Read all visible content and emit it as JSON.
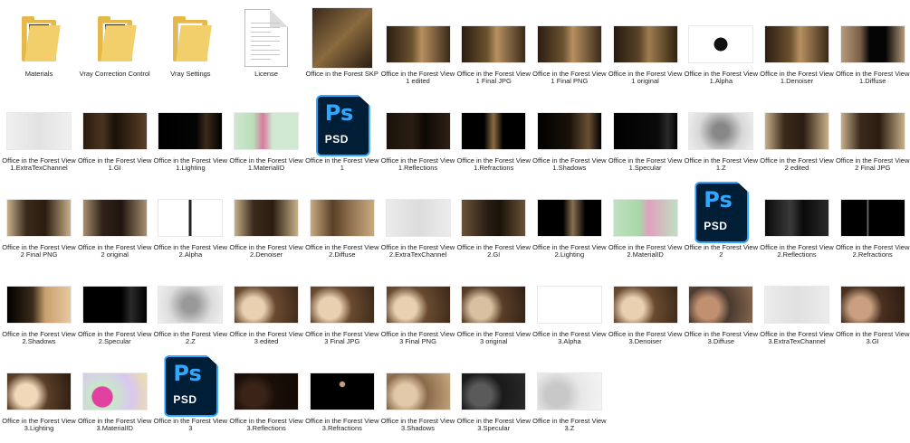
{
  "files": [
    {
      "label": "Materials",
      "kind": "folder",
      "inner": "#2a2a2a"
    },
    {
      "label": "Vray Correction Control",
      "kind": "folder",
      "inner": "#1c2733"
    },
    {
      "label": "Vray Settings",
      "kind": "folder",
      "inner": "#ffffff"
    },
    {
      "label": "License",
      "kind": "doc"
    },
    {
      "label": "Office in the Forest SKP",
      "kind": "square",
      "bg": "linear-gradient(135deg,#3a2a1c,#8a6a3e 50%,#2a1d12)"
    },
    {
      "label": "Office in the Forest View 1 edited",
      "kind": "img",
      "bg": "linear-gradient(90deg,#2b1d12,#6b5230 40%,#b89060 55%,#3a2a1a)"
    },
    {
      "label": "Office in the Forest View 1 Final JPG",
      "kind": "img",
      "bg": "linear-gradient(90deg,#2b1d12,#6b5230 40%,#b89060 55%,#3a2a1a)"
    },
    {
      "label": "Office in the Forest View 1 Final PNG",
      "kind": "img",
      "bg": "linear-gradient(90deg,#2b1d12,#6b5230 40%,#b89060 55%,#3a2a1a)"
    },
    {
      "label": "Office in the Forest View 1 original",
      "kind": "img",
      "bg": "linear-gradient(90deg,#251a10,#5b4428 40%,#a07c50 55%,#30220f)"
    },
    {
      "label": "Office in the Forest View 1.Alpha",
      "kind": "img",
      "bg": "radial-gradient(circle at 50% 50%,#111 0 18%,#ffffff 19%)"
    },
    {
      "label": "Office in the Forest View 1.Denoiser",
      "kind": "img",
      "bg": "linear-gradient(90deg,#2b1d12,#6b5230 40%,#b89060 55%,#3a2a1a)"
    },
    {
      "label": "Office in the Forest View 1.Diffuse",
      "kind": "img",
      "bg": "linear-gradient(90deg,#b59a7a,#7a6048 30%,#050505 45%,#050505 70%,#b59a7a)"
    },
    {
      "label": "Office in the Forest View 1.ExtraTexChannel",
      "kind": "img",
      "bg": "linear-gradient(90deg,#f0f0f0,#e2e2e2 50%,#f0f0f0)"
    },
    {
      "label": "Office in the Forest View 1.GI",
      "kind": "img",
      "bg": "linear-gradient(90deg,#2a1a0e,#4a3420 30%,#1a1108 50%,#5a4026)"
    },
    {
      "label": "Office in the Forest View 1.Lighting",
      "kind": "img",
      "bg": "linear-gradient(90deg,#000,#050505 60%,#3a2a18 75%,#000)"
    },
    {
      "label": "Office in the Forest View 1.MaterialID",
      "kind": "img",
      "bg": "linear-gradient(90deg,#cfe8cf,#b8ddb8 30%,#d97aa0 45%,#cfe8cf 60%)"
    },
    {
      "label": "Office in the Forest View 1",
      "kind": "psd"
    },
    {
      "label": "Office in the Forest View 1.Reflections",
      "kind": "img",
      "bg": "linear-gradient(90deg,#1a120a,#2a1e12 40%,#0e0904 60%,#2e2016)"
    },
    {
      "label": "Office in the Forest View 1.Refractions",
      "kind": "img",
      "bg": "linear-gradient(90deg,#000,#000 35%,#8a6c42 50%,#000 65%)"
    },
    {
      "label": "Office in the Forest View 1.Shadows",
      "kind": "img",
      "bg": "linear-gradient(90deg,#000,#1a120a 50%,#6a5032 80%,#000)"
    },
    {
      "label": "Office in the Forest View 1.Specular",
      "kind": "img",
      "bg": "linear-gradient(90deg,#000,#0a0a0a 70%,#2a2a2a 85%,#000)"
    },
    {
      "label": "Office in the Forest View 1.Z",
      "kind": "img",
      "bg": "radial-gradient(circle at 50% 50%,#888 0 20%,#d8d8d8 60%,#eeeeee)"
    },
    {
      "label": "Office in the Forest View 2 edited",
      "kind": "img",
      "bg": "linear-gradient(90deg,#c8b08a,#3a2a1c 30%,#2a1c10 60%,#c8b08a)"
    },
    {
      "label": "Office in the Forest View 2 Final JPG",
      "kind": "img",
      "bg": "linear-gradient(90deg,#c8b08a,#3a2a1c 30%,#2a1c10 60%,#c8b08a)"
    },
    {
      "label": "Office in the Forest View 2 Final PNG",
      "kind": "img",
      "bg": "linear-gradient(90deg,#c8b08a,#3a2a1c 30%,#2a1c10 60%,#c8b08a)"
    },
    {
      "label": "Office in the Forest View 2 original",
      "kind": "img",
      "bg": "linear-gradient(90deg,#a89070,#30221a 30%,#201510 60%,#a89070)"
    },
    {
      "label": "Office in the Forest View 2.Alpha",
      "kind": "img",
      "bg": "linear-gradient(90deg,#fff 48%,#222 48%,#222 52%,#fff 52%)"
    },
    {
      "label": "Office in the Forest View 2.Denoiser",
      "kind": "img",
      "bg": "linear-gradient(90deg,#c8b08a,#3a2a1c 30%,#2a1c10 60%,#c8b08a)"
    },
    {
      "label": "Office in the Forest View 2.Diffuse",
      "kind": "img",
      "bg": "linear-gradient(90deg,#c8aa82,#5a4028 35%,#8a6c4a 60%,#c8aa82)"
    },
    {
      "label": "Office in the Forest View 2.ExtraTexChannel",
      "kind": "img",
      "bg": "linear-gradient(90deg,#ececec,#dcdcdc 50%,#ececec)"
    },
    {
      "label": "Office in the Forest View 2.GI",
      "kind": "img",
      "bg": "linear-gradient(90deg,#6a5238,#2a1e14 40%,#1a120a 60%,#6a5238)"
    },
    {
      "label": "Office in the Forest View 2.Lighting",
      "kind": "img",
      "bg": "linear-gradient(90deg,#000,#000 40%,#8a7050 55%,#000 75%)"
    },
    {
      "label": "Office in the Forest View 2.MaterialID",
      "kind": "img",
      "bg": "linear-gradient(90deg,#bfe0bf,#a8d8a8 40%,#e0a0c0 55%,#bfe0bf)"
    },
    {
      "label": "Office in the Forest View 2",
      "kind": "psd"
    },
    {
      "label": "Office in the Forest View 2.Reflections",
      "kind": "img",
      "bg": "linear-gradient(90deg,#0a0a0a,#3a3a3a 40%,#0a0a0a 60%,#2a2a2a)"
    },
    {
      "label": "Office in the Forest View 2.Refractions",
      "kind": "img",
      "bg": "linear-gradient(90deg,#000 40%,#888 42%,#000 44%)"
    },
    {
      "label": "Office in the Forest View 2.Shadows",
      "kind": "img",
      "bg": "linear-gradient(90deg,#000,#3a2a1a 40%,#c8a070 60%,#e8c8a0)"
    },
    {
      "label": "Office in the Forest View 2.Specular",
      "kind": "img",
      "bg": "linear-gradient(90deg,#000,#000 60%,#2a2a2a 75%,#000)"
    },
    {
      "label": "Office in the Forest View 2.Z",
      "kind": "img",
      "bg": "radial-gradient(circle at 50% 50%,#999 0 20%,#dcdcdc 60%,#f0f0f0)"
    },
    {
      "label": "Office in the Forest View 3 edited",
      "kind": "img",
      "bg": "radial-gradient(circle at 30% 60%,#e8d0b0 0 22%,#6a4a30 45%,#3a2818)"
    },
    {
      "label": "Office in the Forest View 3 Final JPG",
      "kind": "img",
      "bg": "radial-gradient(circle at 30% 60%,#e8d0b0 0 22%,#6a4a30 45%,#3a2818)"
    },
    {
      "label": "Office in the Forest View 3 Final PNG",
      "kind": "img",
      "bg": "radial-gradient(circle at 30% 60%,#e8d0b0 0 22%,#6a4a30 45%,#3a2818)"
    },
    {
      "label": "Office in the Forest View 3 original",
      "kind": "img",
      "bg": "radial-gradient(circle at 30% 60%,#d8c0a0 0 22%,#5a3e28 45%,#302014)"
    },
    {
      "label": "Office in the Forest View 3.Alpha",
      "kind": "img",
      "bg": "linear-gradient(90deg,#ffffff,#ffffff)"
    },
    {
      "label": "Office in the Forest View 3.Denoiser",
      "kind": "img",
      "bg": "radial-gradient(circle at 30% 60%,#e8d0b0 0 22%,#6a4a30 45%,#3a2818)"
    },
    {
      "label": "Office in the Forest View 3.Diffuse",
      "kind": "img",
      "bg": "radial-gradient(circle at 30% 60%,#c09070 0 22%,#4a3a30 45%,#8a6a50)"
    },
    {
      "label": "Office in the Forest View 3.ExtraTexChannel",
      "kind": "img",
      "bg": "linear-gradient(90deg,#ececec,#e0e0e0 50%,#ececec)"
    },
    {
      "label": "Office in the Forest View 3.GI",
      "kind": "img",
      "bg": "radial-gradient(circle at 30% 60%,#c8a080 0 22%,#4a3020 45%,#2a1a10)"
    },
    {
      "label": "Office in the Forest View 3.Lighting",
      "kind": "img",
      "bg": "radial-gradient(circle at 30% 60%,#f0d8b8 0 22%,#5a3e28 45%,#2a1a10)"
    },
    {
      "label": "Office in the Forest View 3.MaterialID",
      "kind": "img",
      "bg": "radial-gradient(circle at 30% 65%,#e040a0 0 20%,#c8e8c8 22%,#d8c8f0 60%,#f0e0a0)"
    },
    {
      "label": "Office in the Forest View 3",
      "kind": "psd"
    },
    {
      "label": "Office in the Forest View 3.Reflections",
      "kind": "img",
      "bg": "radial-gradient(circle at 30% 60%,#3a2418 0 22%,#1a0e08 45%,#120a04)"
    },
    {
      "label": "Office in the Forest View 3.Refractions",
      "kind": "img",
      "bg": "radial-gradient(circle at 50% 30%,#c8a080 0 6%,#000 8%)"
    },
    {
      "label": "Office in the Forest View 3.Shadows",
      "kind": "img",
      "bg": "radial-gradient(circle at 30% 60%,#e0c8a8 0 22%,#8a6a4a 45%,#c8a880)"
    },
    {
      "label": "Office in the Forest View 3.Specular",
      "kind": "img",
      "bg": "radial-gradient(circle at 30% 60%,#5a5a5a 0 22%,#1a1a1a 45%,#2a2a2a)"
    },
    {
      "label": "Office in the Forest View 3.Z",
      "kind": "img",
      "bg": "radial-gradient(circle at 30% 60%,#c8c8c8 0 22%,#e8e8e8 50%,#f4f4f4)"
    }
  ],
  "icons": {
    "psd_main": "Ps",
    "psd_ext": "PSD"
  }
}
